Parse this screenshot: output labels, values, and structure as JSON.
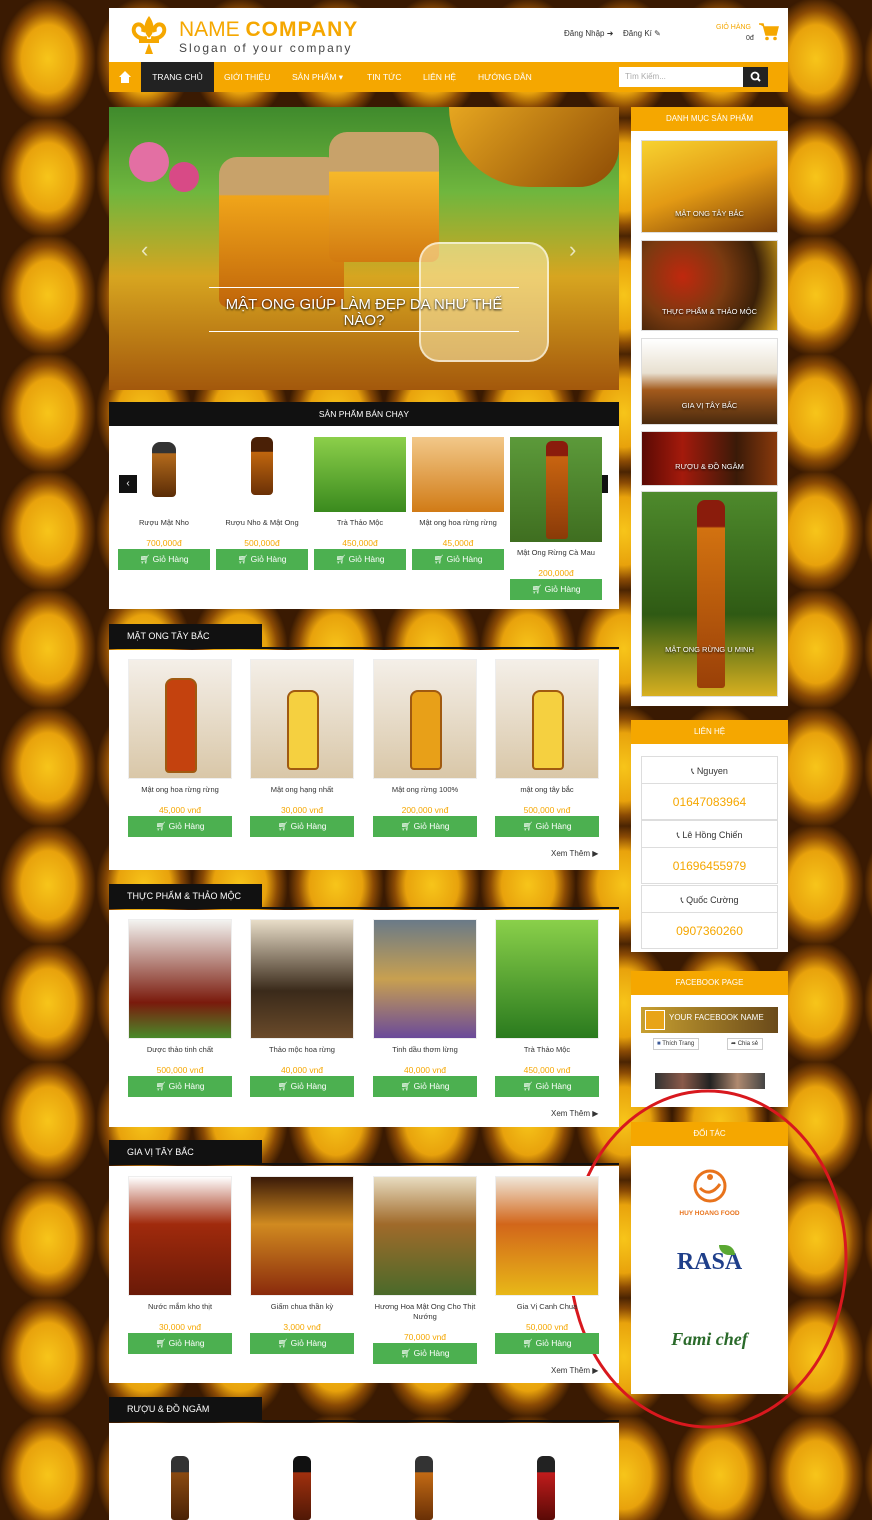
{
  "header": {
    "logo_name": "NAME ",
    "logo_name_bold": "COMPANY",
    "slogan": "Slogan of your company",
    "login": "Đăng Nhập",
    "register": "Đăng Kí",
    "cart_label": "GIỎ HÀNG",
    "cart_amount": "0đ"
  },
  "nav": {
    "items": [
      "TRANG CHỦ",
      "GIỚI THIỆU",
      "SẢN PHẨM ▾",
      "TIN TỨC",
      "LIÊN HỆ",
      "HƯỚNG DẪN"
    ],
    "search_placeholder": "Tìm Kiếm..."
  },
  "slider": {
    "caption": "MẬT ONG GIÚP LÀM ĐẸP DA NHƯ THẾ NÀO?"
  },
  "bestseller": {
    "title": "SẢN PHẨM BÁN CHẠY",
    "items": [
      {
        "name": "Rượu Mật Nho",
        "price": "700,000đ"
      },
      {
        "name": "Rượu Nho & Mật Ong",
        "price": "500,000đ"
      },
      {
        "name": "Trà Thảo Mộc",
        "price": "450,000đ"
      },
      {
        "name": "Mật ong hoa rừng rừng",
        "price": "45,000đ"
      },
      {
        "name": "Mật Ong Rừng Cà Mau",
        "price": "200,000đ"
      }
    ]
  },
  "cart_btn": "Giỏ Hàng",
  "see_more": "Xem Thêm ▶",
  "sections": [
    {
      "title": "MẬT ONG TÂY BẮC",
      "items": [
        {
          "name": "Mật ong hoa rừng rừng",
          "price": "45,000 vnđ"
        },
        {
          "name": "Mật ong hạng nhất",
          "price": "30,000 vnđ"
        },
        {
          "name": "Mật ong rừng 100%",
          "price": "200,000 vnđ"
        },
        {
          "name": "mật ong tây bắc",
          "price": "500,000 vnđ"
        }
      ]
    },
    {
      "title": "THỰC PHẨM & THẢO MỘC",
      "items": [
        {
          "name": "Dược thảo tinh chất",
          "price": "500,000 vnđ"
        },
        {
          "name": "Thảo mộc hoa rừng",
          "price": "40,000 vnđ"
        },
        {
          "name": "Tinh dầu thơm lừng",
          "price": "40,000 vnđ"
        },
        {
          "name": "Trà Thảo Mộc",
          "price": "450,000 vnđ"
        }
      ]
    },
    {
      "title": "GIA VỊ TÂY BẮC",
      "items": [
        {
          "name": "Nước mắm kho thịt",
          "price": "30,000 vnđ"
        },
        {
          "name": "Giấm chua thần kỳ",
          "price": "3,000 vnđ"
        },
        {
          "name": "Hương Hoa Mật Ong Cho Thịt Nướng",
          "price": "70,000 vnđ"
        },
        {
          "name": "Gia Vị Canh Chua",
          "price": "50,000 vnđ"
        }
      ]
    },
    {
      "title": "RƯỢU & ĐỒ NGÂM"
    }
  ],
  "sidebar": {
    "categories_title": "DANH MỤC SẢN PHẨM",
    "categories": [
      "MẬT ONG TÂY BẮC",
      "THỰC PHẨM & THẢO MỘC",
      "GIA VỊ TÂY BẮC",
      "RƯỢU & ĐỒ NGÂM",
      "MẬT ONG RỪNG U MINH"
    ],
    "contact_title": "LIÊN HỆ",
    "contacts": [
      {
        "name": "Nguyen",
        "phone": "01647083964"
      },
      {
        "name": "Lê Hồng Chiến",
        "phone": "01696455979"
      },
      {
        "name": "Quốc Cường",
        "phone": "0907360260"
      }
    ],
    "facebook_title": "FACEBOOK PAGE",
    "facebook_name": "YOUR FACEBOOK NAME",
    "facebook_like": "Thích Trang",
    "facebook_share": "Chia sẻ",
    "partners_title": "ĐỐI TÁC",
    "partners": [
      "HUY HOANG FOOD",
      "RASA",
      "Fami chef"
    ]
  },
  "colors": {
    "accent": "#f5a700",
    "dark": "#111111",
    "button": "#4cb050",
    "annotation": "#d8181e"
  }
}
